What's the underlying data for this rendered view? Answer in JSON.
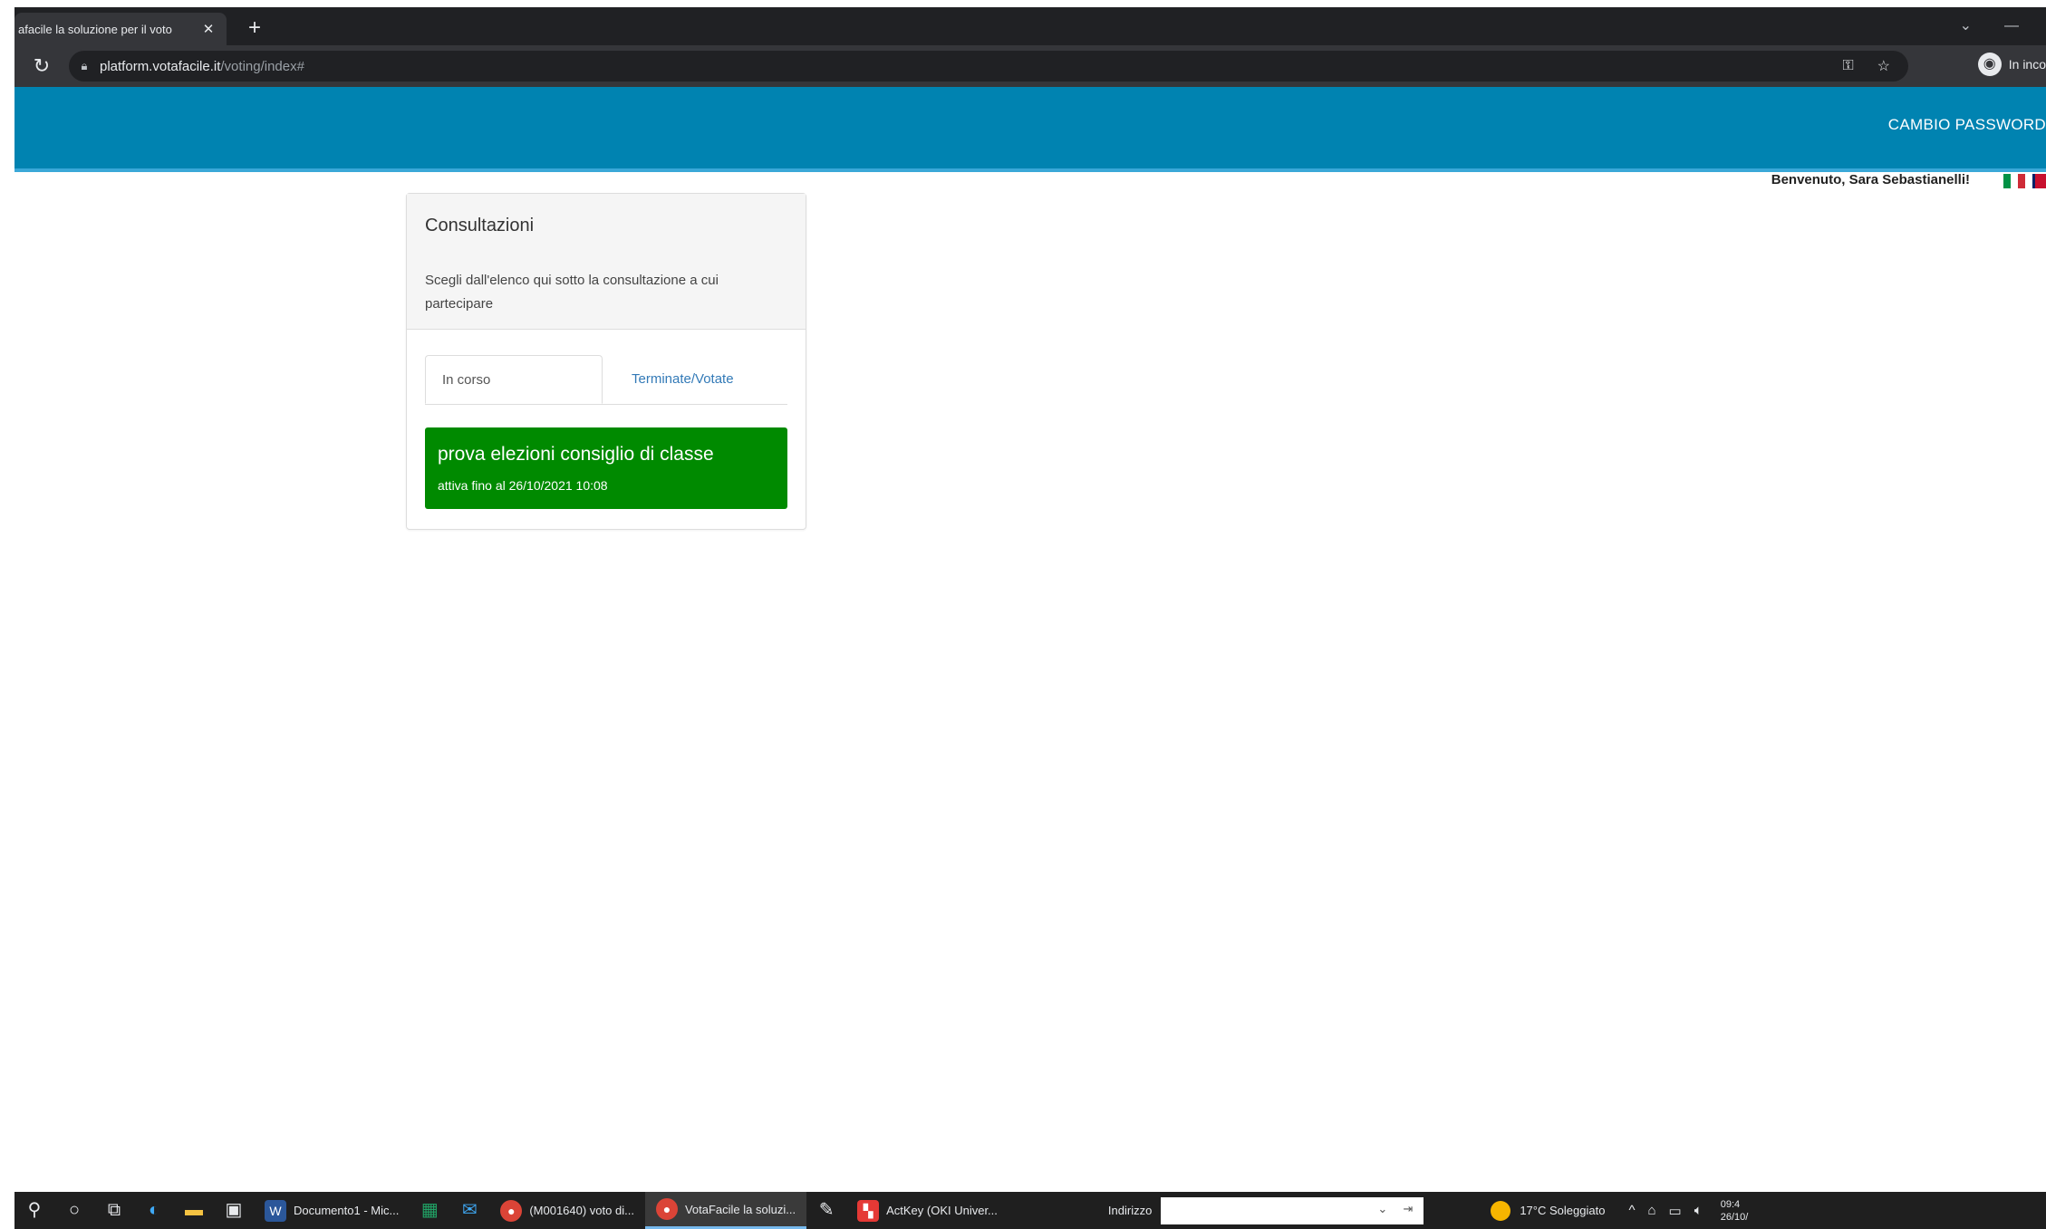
{
  "browser": {
    "tab_title": "afacile la soluzione per il voto",
    "tab_close": "✕",
    "new_tab": "+",
    "win_min": "—",
    "win_menu": "⌄",
    "url_host": "platform.votafacile.it",
    "url_path": "/voting/index#",
    "profile_label": "In inco"
  },
  "navbar": {
    "change_password": "CAMBIO PASSWORD"
  },
  "user": {
    "welcome": "Benvenuto,  Sara Sebastianelli!"
  },
  "panel": {
    "title": "Consultazioni",
    "description": "Scegli dall'elenco qui sotto la consultazione a cui partecipare",
    "tabs": [
      {
        "label": "In corso",
        "active": true
      },
      {
        "label": "Terminate/Votate",
        "active": false
      }
    ],
    "items": [
      {
        "title": "prova elezioni consiglio di classe",
        "subtitle": "attiva fino al 26/10/2021 10:08"
      }
    ]
  },
  "taskbar": {
    "apps": [
      {
        "label": "Documento1 - Mic..."
      },
      {
        "label": "(M001640) voto di..."
      },
      {
        "label": "VotaFacile la soluzi..."
      },
      {
        "label": "ActKey (OKI Univer..."
      }
    ],
    "address_label": "Indirizzo",
    "weather": "17°C  Soleggiato",
    "clock": "09:4",
    "date": "26/10/"
  },
  "colors": {
    "navbar": "#0083b1",
    "item_green": "#008a00",
    "tab_link": "#337ab7"
  }
}
